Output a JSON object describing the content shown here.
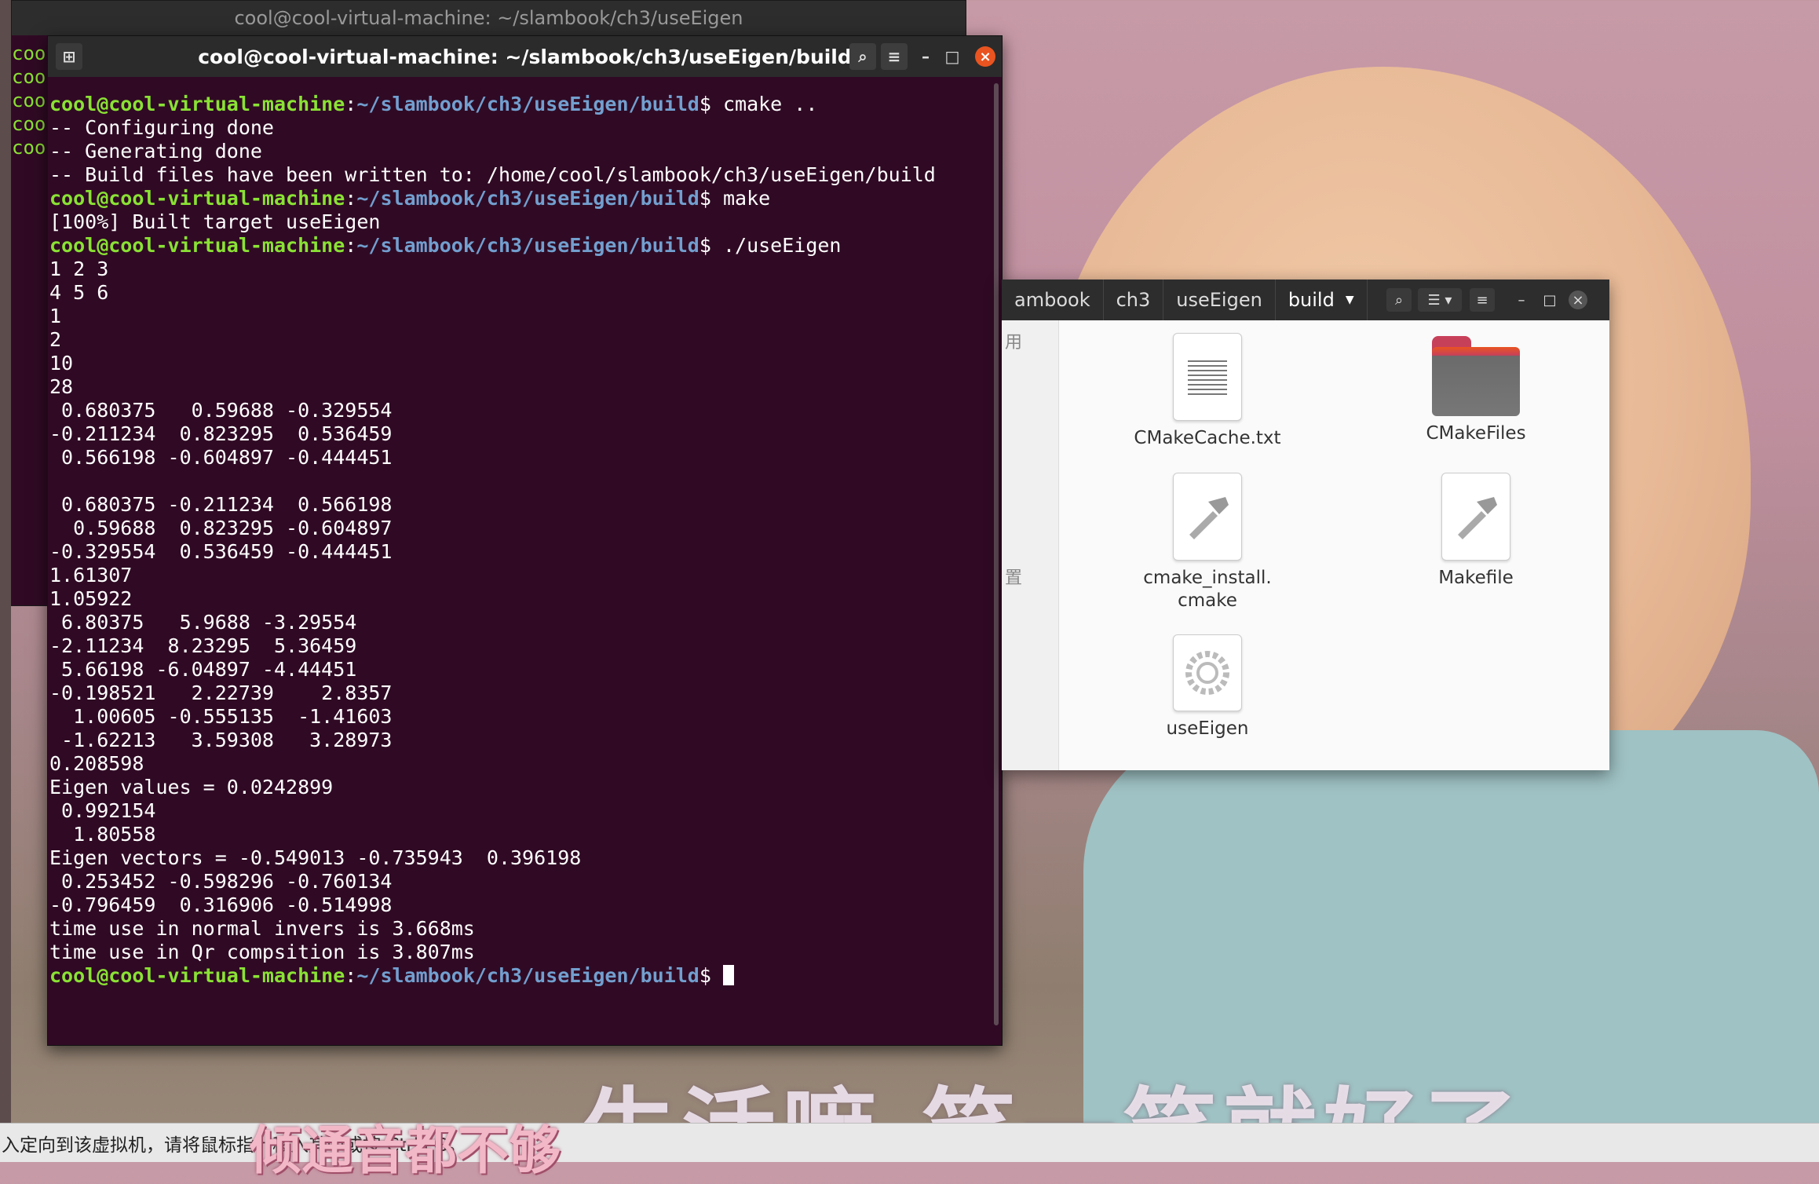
{
  "wallpaper": {
    "caption": "生活嘛 笑一笑就好了",
    "colors": {
      "sky": "#c79aa7",
      "skin": "#e8b996",
      "shirt": "#9fc2c4"
    }
  },
  "back_terminal": {
    "title": "cool@cool-virtual-machine: ~/slambook/ch3/useEigen",
    "lines": [
      "coo",
      "coo",
      "coo",
      "coo",
      "coo"
    ]
  },
  "terminal": {
    "title": "cool@cool-virtual-machine: ~/slambook/ch3/useEigen/build",
    "user_host": "cool@cool-virtual-machine",
    "path": "~/slambook/ch3/useEigen/build",
    "commands": [
      "cmake ..",
      "make",
      "./useEigen",
      ""
    ],
    "cmake_output": [
      "-- Configuring done",
      "-- Generating done",
      "-- Build files have been written to: /home/cool/slambook/ch3/useEigen/build"
    ],
    "make_output": [
      "[100%] Built target useEigen"
    ],
    "program_output": [
      "1 2 3",
      "4 5 6",
      "1",
      "2",
      "10",
      "28",
      " 0.680375   0.59688 -0.329554",
      "-0.211234  0.823295  0.536459",
      " 0.566198 -0.604897 -0.444451",
      "",
      " 0.680375 -0.211234  0.566198",
      "  0.59688  0.823295 -0.604897",
      "-0.329554  0.536459 -0.444451",
      "1.61307",
      "1.05922",
      " 6.80375   5.9688 -3.29554",
      "-2.11234  8.23295  5.36459",
      " 5.66198 -6.04897 -4.44451",
      "-0.198521   2.22739    2.8357",
      "  1.00605 -0.555135  -1.41603",
      " -1.62213   3.59308   3.28973",
      "0.208598",
      "Eigen values = 0.0242899",
      " 0.992154",
      "  1.80558",
      "Eigen vectors = -0.549013 -0.735943  0.396198",
      " 0.253452 -0.598296 -0.760134",
      "-0.796459  0.316906 -0.514998",
      "time use in normal invers is 3.668ms",
      "time use in Qr compsition is 3.807ms"
    ],
    "colors": {
      "background": "#300a24",
      "user": "#8ae234",
      "path": "#729fcf"
    }
  },
  "file_manager": {
    "breadcrumbs": [
      "ambook",
      "ch3",
      "useEigen",
      "build"
    ],
    "sidebar_fragments": [
      "用",
      "置"
    ],
    "files": [
      {
        "name": "CMakeCache.txt",
        "icon": "text-file-icon"
      },
      {
        "name": "CMakeFiles",
        "icon": "folder-icon"
      },
      {
        "name": "cmake_install.\ncmake",
        "icon": "hammer-file-icon"
      },
      {
        "name": "Makefile",
        "icon": "hammer-file-icon"
      },
      {
        "name": "useEigen",
        "icon": "gear-file-icon"
      }
    ]
  },
  "bottom_bar": {
    "text": "入定向到该虚拟机，请将鼠标指针移入其中或按 Ctrl+G。",
    "overlay": "倾通音都不够"
  }
}
